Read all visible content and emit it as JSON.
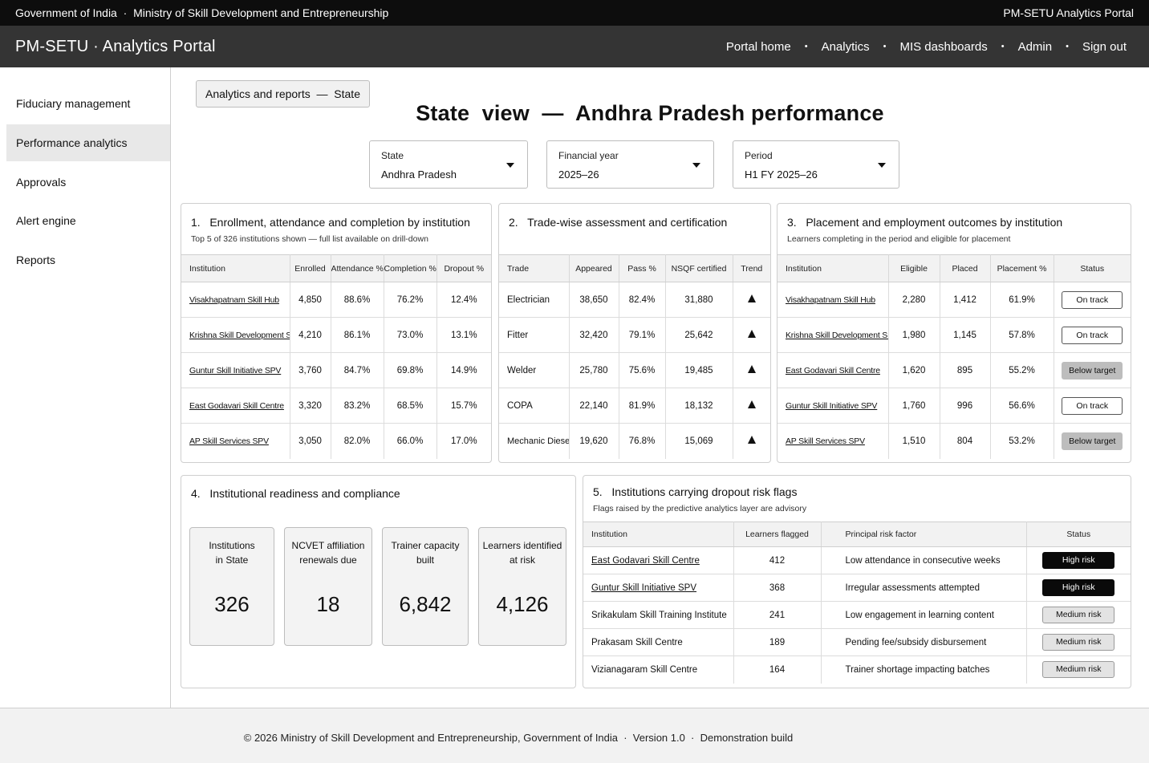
{
  "topbar": {
    "org": "Government of India  ·  Ministry of Skill Development and Entrepreneurship",
    "portal": "PM-SETU Analytics Portal"
  },
  "header": {
    "brand": "PM-SETU · Analytics Portal",
    "nav": [
      {
        "label": "Portal home"
      },
      {
        "label": "Analytics"
      },
      {
        "label": "MIS dashboards"
      },
      {
        "label": "Admin"
      },
      {
        "label": "Sign out"
      }
    ],
    "separator": "•"
  },
  "sidebar": {
    "items": [
      {
        "label": "Fiduciary management"
      },
      {
        "label": "Performance analytics"
      },
      {
        "label": "Approvals"
      },
      {
        "label": "Alert engine"
      },
      {
        "label": "Reports"
      }
    ]
  },
  "breadcrumb": "Analytics and reports  —  State",
  "page_title": "State  view  —  Andhra Pradesh performance",
  "filters": [
    {
      "label": "State",
      "value": "Andhra Pradesh"
    },
    {
      "label": "Financial year",
      "value": "2025–26"
    },
    {
      "label": "Period",
      "value": "H1 FY 2025–26"
    }
  ],
  "panel1": {
    "title": "1.   Enrollment, attendance and completion by institution",
    "subtitle": "Top 5 of 326 institutions shown — full list available on drill-down",
    "headers": [
      "Institution",
      "Enrolled",
      "Attendance %",
      "Completion %",
      "Dropout %"
    ],
    "rows": [
      [
        "Visakhapatnam Skill Hub",
        "4,850",
        "88.6%",
        "76.2%",
        "12.4%"
      ],
      [
        "Krishna Skill Development SPV",
        "4,210",
        "86.1%",
        "73.0%",
        "13.1%"
      ],
      [
        "Guntur Skill Initiative SPV",
        "3,760",
        "84.7%",
        "69.8%",
        "14.9%"
      ],
      [
        "East Godavari Skill Centre",
        "3,320",
        "83.2%",
        "68.5%",
        "15.7%"
      ],
      [
        "AP Skill Services SPV",
        "3,050",
        "82.0%",
        "66.0%",
        "17.0%"
      ]
    ]
  },
  "panel2": {
    "title": "2.   Trade-wise assessment and certification",
    "headers": [
      "Trade",
      "Appeared",
      "Pass %",
      "NSQF certified",
      "Trend"
    ],
    "rows": [
      [
        "Electrician",
        "38,650",
        "82.4%",
        "31,880"
      ],
      [
        "Fitter",
        "32,420",
        "79.1%",
        "25,642"
      ],
      [
        "Welder",
        "25,780",
        "75.6%",
        "19,485"
      ],
      [
        "COPA",
        "22,140",
        "81.9%",
        "18,132"
      ],
      [
        "Mechanic Diesel",
        "19,620",
        "76.8%",
        "15,069"
      ]
    ],
    "trend_icon": "up-triangle-icon"
  },
  "panel3": {
    "title": "3.   Placement and employment outcomes by institution",
    "subtitle": "Learners completing in the period and eligible for placement",
    "headers": [
      "Institution",
      "Eligible",
      "Placed",
      "Placement %",
      "Status"
    ],
    "rows": [
      [
        "Visakhapatnam Skill Hub",
        "2,280",
        "1,412",
        "61.9%",
        "On track"
      ],
      [
        "Krishna Skill Development SPV",
        "1,980",
        "1,145",
        "57.8%",
        "On track"
      ],
      [
        "East Godavari Skill Centre",
        "1,620",
        "895",
        "55.2%",
        "Below target"
      ],
      [
        "Guntur Skill Initiative SPV",
        "1,760",
        "996",
        "56.6%",
        "On track"
      ],
      [
        "AP Skill Services SPV",
        "1,510",
        "804",
        "53.2%",
        "Below target"
      ]
    ]
  },
  "panel4": {
    "title": "4.   Institutional readiness and compliance",
    "kpis": [
      {
        "label_1": "Institutions",
        "label_2": "in State",
        "value": "326"
      },
      {
        "label_1": "NCVET affiliation",
        "label_2": "renewals due",
        "value": "18"
      },
      {
        "label_1": "Trainer capacity",
        "label_2": "built",
        "value": "6,842"
      },
      {
        "label_1": "Learners identified",
        "label_2": "at risk",
        "value": "4,126"
      }
    ]
  },
  "panel5": {
    "title": "5.   Institutions carrying dropout risk flags",
    "subtitle": "Flags raised by the predictive analytics layer are advisory",
    "headers": [
      "Institution",
      "Learners flagged",
      "Principal risk factor",
      "Status"
    ],
    "rows": [
      [
        "East Godavari Skill Centre",
        "412",
        "Low attendance in consecutive weeks",
        "High risk"
      ],
      [
        "Guntur Skill Initiative SPV",
        "368",
        "Irregular assessments attempted",
        "High risk"
      ],
      [
        "Srikakulam Skill Training Institute",
        "241",
        "Low engagement in learning content",
        "Medium risk"
      ],
      [
        "Prakasam Skill Centre",
        "189",
        "Pending fee/subsidy disbursement",
        "Medium risk"
      ],
      [
        "Vizianagaram Skill Centre",
        "164",
        "Trainer shortage impacting batches",
        "Medium risk"
      ]
    ]
  },
  "footer": "© 2026 Ministry of Skill Development and Entrepreneurship, Government of India  ·  Version 1.0  ·  Demonstration build"
}
